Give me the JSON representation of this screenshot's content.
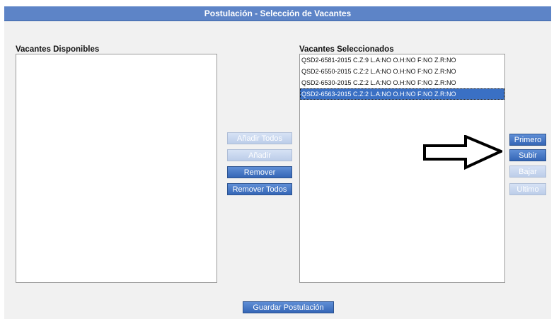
{
  "header": {
    "title": "Postulación - Selección de Vacantes"
  },
  "available": {
    "label": "Vacantes Disponibles",
    "items": []
  },
  "selected": {
    "label": "Vacantes Seleccionados",
    "items": [
      "QSD2-6581-2015 C.Z:9 L.A:NO O.H:NO F:NO Z.R:NO",
      "QSD2-6550-2015 C.Z:2 L.A:NO O.H:NO F:NO Z.R:NO",
      "QSD2-6530-2015 C.Z:2 L.A:NO O.H:NO F:NO Z.R:NO",
      "QSD2-6563-2015 C.Z:2 L.A:NO O.H:NO F:NO Z.R:NO"
    ],
    "selected_index": 3
  },
  "transfer_buttons": {
    "add_all": "Añadir Todos",
    "add": "Añadir",
    "remove": "Remover",
    "remove_all": "Remover Todos"
  },
  "order_buttons": {
    "first": "Primero",
    "up": "Subir",
    "down": "Bajar",
    "last": "Ultimo"
  },
  "footer": {
    "save_label": "Guardar Postulación"
  },
  "colors": {
    "accent": "#5d84c7",
    "button_active": "#3a6cbd",
    "button_disabled": "#c9d7ee",
    "panel_bg": "#f1f1f1"
  },
  "annotation": {
    "icon": "arrow-right-icon"
  }
}
